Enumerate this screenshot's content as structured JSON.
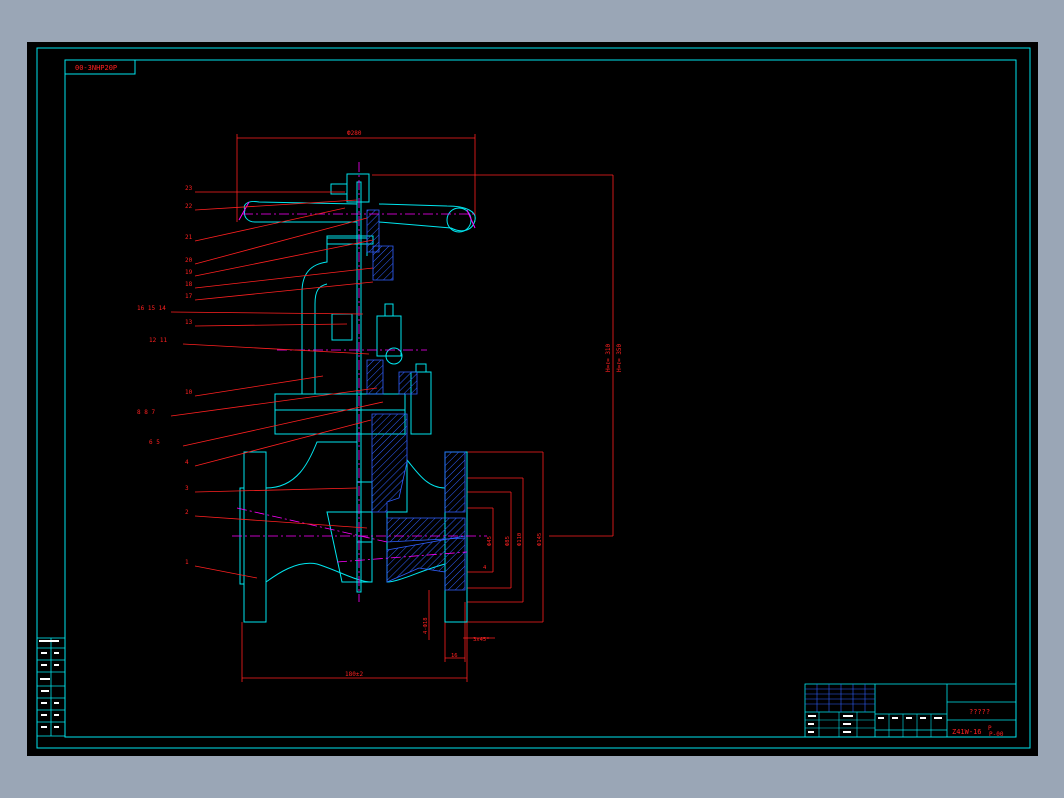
{
  "sheet": {
    "code_tag": "00-3NHP20P",
    "colors": {
      "background": "#000000",
      "frame": "#00e5ee",
      "leader": "#ff2020",
      "centerline": "#ff00ff",
      "part": "#00e5ee",
      "hatch": "#3060ff",
      "handwheel_mark": "#ff00ff",
      "screen_bg": "#9aa6b6"
    }
  },
  "part_labels": [
    "23",
    "22",
    "21",
    "20",
    "19",
    "18",
    "17",
    "16 15 14",
    "13",
    "12 11",
    "10",
    "8 8 7",
    "6 5",
    "4",
    "3",
    "2",
    "1"
  ],
  "dimensions": {
    "handwheel_dia": "Ф280",
    "height": "H=ℓ= 310",
    "height_open": "H=ℓ= 350",
    "flange_d1": "Ф45",
    "flange_d2": "Ф85",
    "flange_d3": "Ф110",
    "flange_d4": "Ф145",
    "thickness": "4-Ф18",
    "bolt_holes": "3x45°",
    "face_offset": "4",
    "flange_thickness": "16",
    "length": "180±2"
  },
  "title_block": {
    "drawing_name": "?????",
    "model": "Z41W-16",
    "suffix": "P",
    "sheet_no": "P-00"
  }
}
